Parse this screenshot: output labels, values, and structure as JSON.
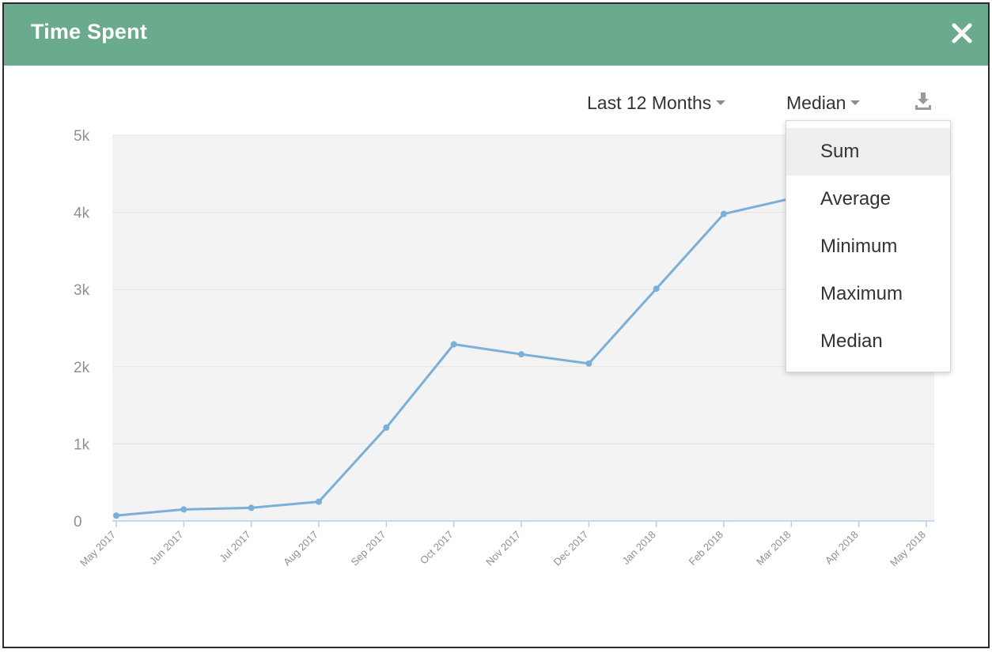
{
  "window": {
    "title": "Time Spent"
  },
  "toolbar": {
    "range_label": "Last 12 Months",
    "metric_label": "Median"
  },
  "dropdown": {
    "items": [
      "Sum",
      "Average",
      "Minimum",
      "Maximum",
      "Median"
    ],
    "highlighted": "Sum"
  },
  "colors": {
    "header": "#6aab8e",
    "line": "#7aafd8",
    "plot_background": "#f3f3f3"
  },
  "icons": {
    "close": "close-icon",
    "download": "download-icon"
  },
  "chart_data": {
    "type": "line",
    "categories": [
      "May 2017",
      "Jun 2017",
      "Jul 2017",
      "Aug 2017",
      "Sep 2017",
      "Oct 2017",
      "Nov 2017",
      "Dec 2017",
      "Jan 2018",
      "Feb 2018",
      "Mar 2018",
      "Apr 2018",
      "May 2018"
    ],
    "values": [
      70,
      150,
      170,
      250,
      1210,
      2290,
      2160,
      2040,
      3010,
      3980,
      4180,
      null,
      null
    ],
    "yticks": [
      "0",
      "1k",
      "2k",
      "3k",
      "4k",
      "5k"
    ],
    "ylim": [
      0,
      5000
    ],
    "grid": true
  }
}
